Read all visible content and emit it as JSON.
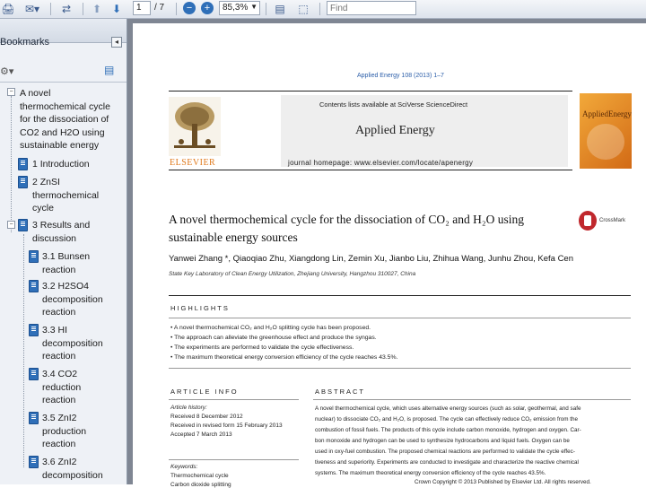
{
  "toolbar": {
    "page_current": "1",
    "page_total": "/ 7",
    "zoom": "85,3%",
    "find_placeholder": "Find"
  },
  "sidebar": {
    "title": "Bookmarks",
    "items": [
      {
        "lines": [
          "A novel",
          "thermochemical cycle",
          "for the dissociation of",
          "CO2 and H2O using",
          "sustainable energy"
        ]
      },
      {
        "lines": [
          "1 Introduction"
        ]
      },
      {
        "lines": [
          "2 ZnSI",
          "thermochemical",
          "cycle"
        ]
      },
      {
        "lines": [
          "3 Results and",
          "discussion"
        ]
      },
      {
        "lines": [
          "3.1 Bunsen",
          "reaction"
        ]
      },
      {
        "lines": [
          "3.2 H2SO4",
          "decomposition",
          "reaction"
        ]
      },
      {
        "lines": [
          "3.3 HI",
          "decomposition",
          "reaction"
        ]
      },
      {
        "lines": [
          "3.4 CO2",
          "reduction",
          "reaction"
        ]
      },
      {
        "lines": [
          "3.5 ZnI2",
          "production",
          "reaction"
        ]
      },
      {
        "lines": [
          "3.6 ZnI2",
          "decomposition"
        ]
      }
    ]
  },
  "paper": {
    "citation": "Applied Energy 108 (2013) 1–7",
    "contents_line": "Contents lists available at SciVerse ScienceDirect",
    "journal_name": "Applied Energy",
    "journal_homepage": "journal homepage: www.elsevier.com/locate/apenergy",
    "publisher": "ELSEVIER",
    "cover_title": "AppliedEnergy",
    "crossmark": "CrossMark",
    "title_line1": "A novel thermochemical cycle for the dissociation of CO₂ and H₂O using",
    "title_line2": "sustainable energy sources",
    "authors": "Yanwei Zhang *, Qiaoqiao Zhu, Xiangdong Lin, Zemin Xu, Jianbo Liu, Zhihua Wang, Junhu Zhou, Kefa Cen",
    "affiliation": "State Key Laboratory of Clean Energy Utilization, Zhejiang University, Hangzhou 310027, China",
    "highlights_heading": "HIGHLIGHTS",
    "highlights": [
      "A novel thermochemical CO₂ and H₂O splitting cycle has been proposed.",
      "The approach can alleviate the greenhouse effect and produce the syngas.",
      "The experiments are performed to validate the cycle effectiveness.",
      "The maximum theoretical energy conversion efficiency of the cycle reaches 43.5%."
    ],
    "article_info_heading": "ARTICLE INFO",
    "article_history": [
      "Article history:",
      "Received 8 December 2012",
      "Received in revised form 15 February 2013",
      "Accepted 7 March 2013"
    ],
    "keywords_heading": "Keywords:",
    "keywords": [
      "Thermochemical cycle",
      "Carbon dioxide splitting"
    ],
    "abstract_heading": "ABSTRACT",
    "abstract_lines": [
      "A novel thermochemical cycle, which uses alternative energy sources (such as solar, geothermal, and safe",
      "nuclear) to dissociate CO₂ and H₂O, is proposed. The cycle can effectively reduce CO₂ emission from the",
      "combustion of fossil fuels. The products of this cycle include carbon monoxide, hydrogen and oxygen. Car-",
      "bon monoxide and hydrogen can be used to synthesize hydrocarbons and liquid fuels. Oxygen can be",
      "used in oxy-fuel combustion. The proposed chemical reactions are performed to validate the cycle effec-",
      "tiveness and superiority. Experiments are conducted to investigate and characterize the reactive chemical",
      "systems. The maximum theoretical energy conversion efficiency of the cycle reaches 43.5%."
    ],
    "copyright": "Crown Copyright © 2013 Published by Elsevier Ltd. All rights reserved."
  }
}
